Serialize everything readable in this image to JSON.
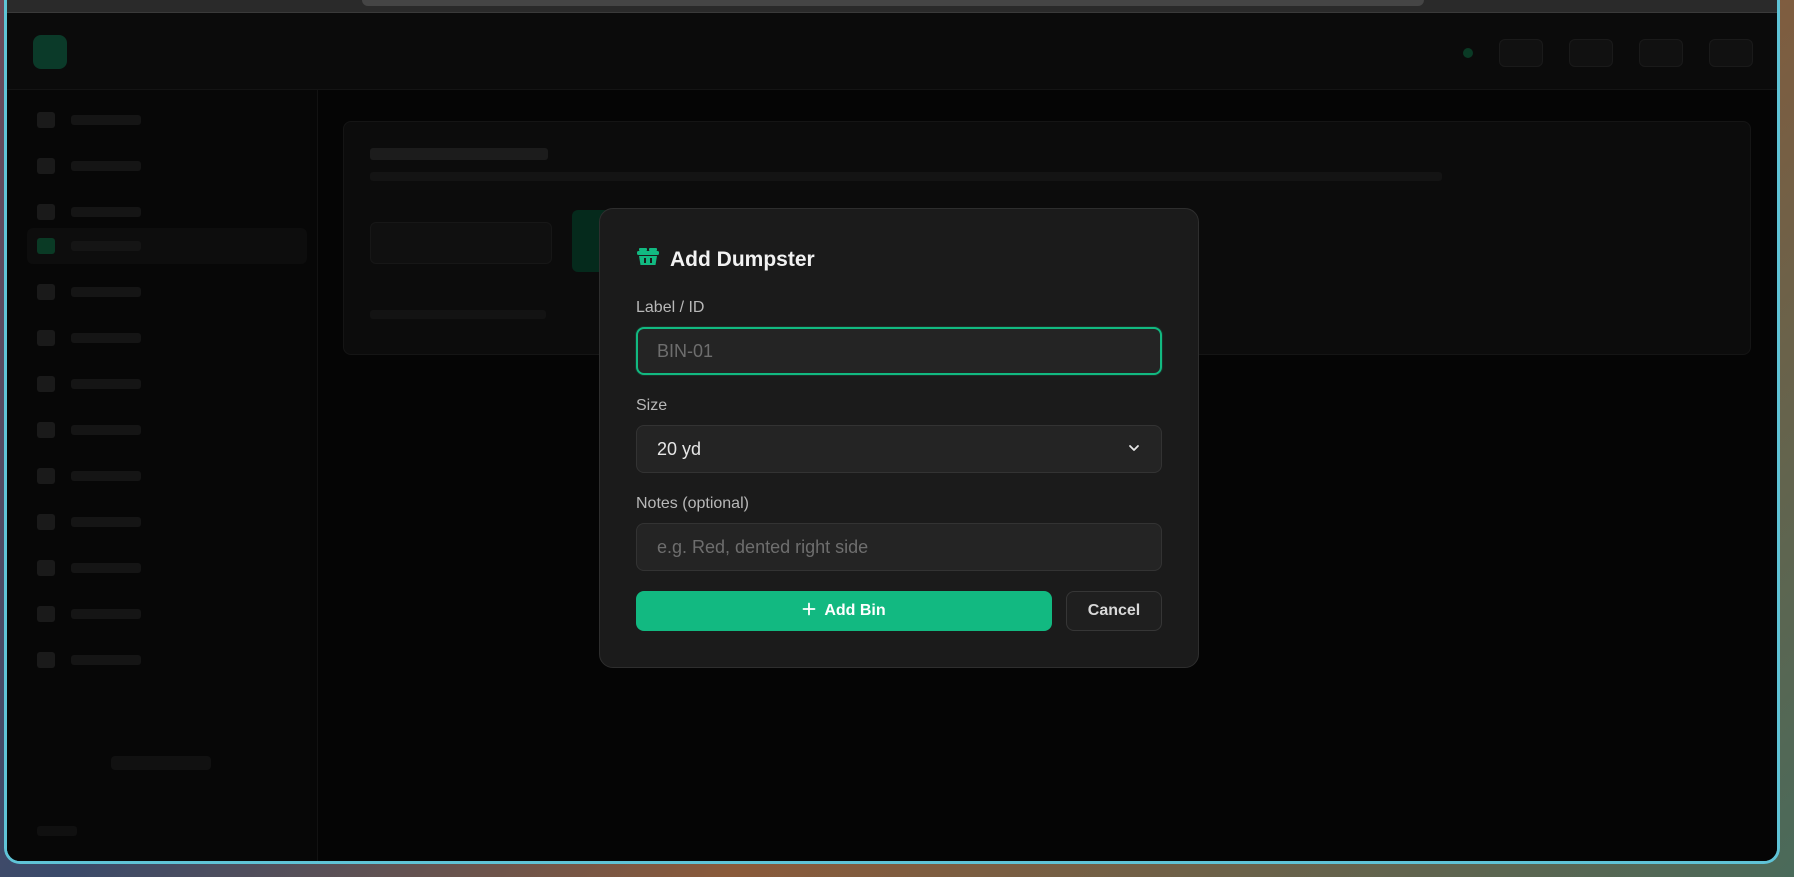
{
  "modal": {
    "title": "Add Dumpster",
    "icon": "dumpster-icon",
    "accent_color": "#12b981",
    "fields": {
      "label": {
        "label": "Label / ID",
        "value": "",
        "placeholder": "BIN-01"
      },
      "size": {
        "label": "Size",
        "value": "20 yd"
      },
      "notes": {
        "label": "Notes (optional)",
        "value": "",
        "placeholder": "e.g. Red, dented right side"
      }
    },
    "buttons": {
      "add": "Add Bin",
      "cancel": "Cancel"
    }
  }
}
